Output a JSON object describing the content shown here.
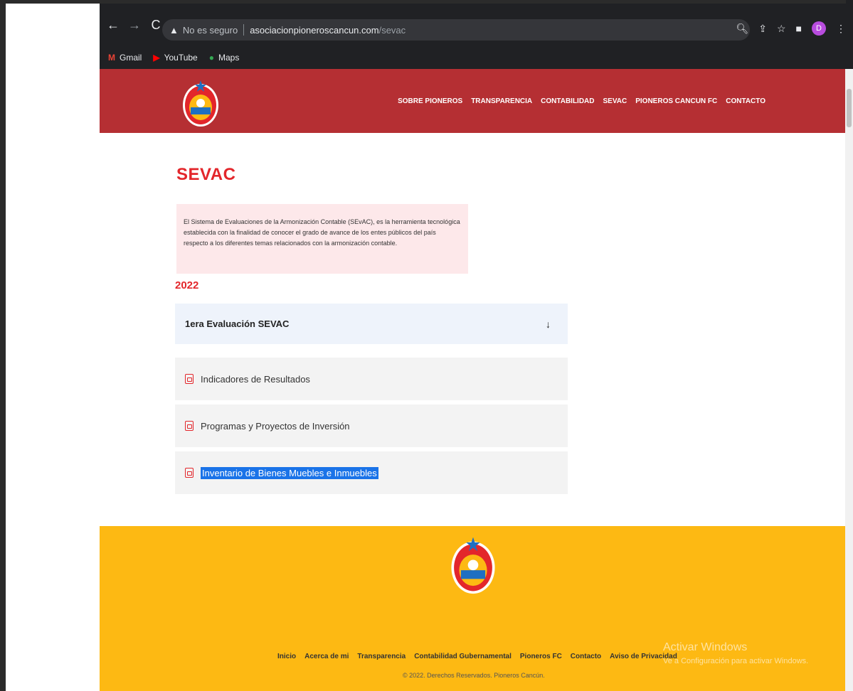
{
  "browser": {
    "security_label": "No es seguro",
    "url_domain": "asociacionpioneroscancun.com",
    "url_path": "/sevac",
    "profile_initial": "D",
    "bookmarks": [
      {
        "label": "Gmail",
        "icon": "gmail-icon"
      },
      {
        "label": "YouTube",
        "icon": "youtube-icon"
      },
      {
        "label": "Maps",
        "icon": "maps-icon"
      }
    ]
  },
  "header": {
    "nav": [
      "SOBRE PIONEROS",
      "TRANSPARENCIA",
      "CONTABILIDAD",
      "SEVAC",
      "PIONEROS CANCUN FC",
      "CONTACTO"
    ],
    "bg_color": "#b52f33"
  },
  "main": {
    "title": "SEVAC",
    "description": "El Sistema de Evaluaciones de la Armonización Contable (SEvAC), es la herramienta tecnológica establecida con la finalidad de conocer el grado de avance de los entes públicos del país respecto a los diferentes temas relacionados con la armonización contable.",
    "year": "2022",
    "accordion": {
      "label": "1era Evaluación SEVAC",
      "icon": "arrow-down-icon"
    },
    "documents": [
      {
        "label": "Indicadores de Resultados",
        "icon": "pdf-icon"
      },
      {
        "label": "Programas y Proyectos de Inversión",
        "icon": "pdf-icon"
      },
      {
        "label": "Inventario de Bienes Muebles e Inmuebles",
        "icon": "pdf-icon",
        "selected": true
      }
    ]
  },
  "footer": {
    "links": [
      "Inicio",
      "Acerca de mi",
      "Transparencia",
      "Contabilidad Gubernamental",
      "Pioneros FC",
      "Contacto",
      "Aviso de Privacidad"
    ],
    "copyright": "© 2022. Derechos Reservados. Pioneros Cancún.",
    "bg_color": "#fdb913"
  },
  "windows_activation": {
    "title": "Activar Windows",
    "subtitle": "Ve a Configuración para activar Windows."
  },
  "colors": {
    "accent_red": "#e3262b",
    "selection_blue": "#1a73e8"
  }
}
